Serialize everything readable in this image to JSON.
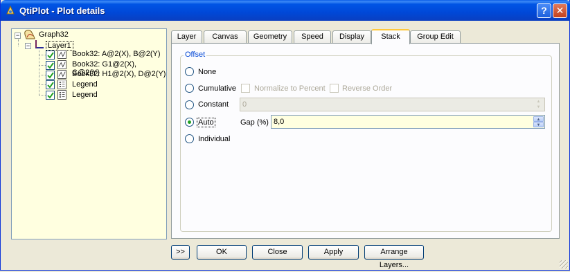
{
  "window": {
    "title": "QtiPlot - Plot details",
    "help_glyph": "?",
    "close_glyph": "✕"
  },
  "tree": {
    "graph_label": "Graph32",
    "layer_label": "Layer1",
    "items": [
      {
        "label": "Book32: A@2(X), B@2(Y)",
        "icon": "curve-icon",
        "checked": true
      },
      {
        "label": "Book32: G1@2(X), C@2(Y)",
        "icon": "curve-icon",
        "checked": true
      },
      {
        "label": "Book32: H1@2(X), D@2(Y)",
        "icon": "curve-icon",
        "checked": true
      },
      {
        "label": "Legend",
        "icon": "legend-icon",
        "checked": true
      },
      {
        "label": "Legend",
        "icon": "legend-icon",
        "checked": true
      }
    ]
  },
  "tabs": [
    "Layer",
    "Canvas",
    "Geometry",
    "Speed",
    "Display",
    "Stack",
    "Group Edit"
  ],
  "active_tab": "Stack",
  "offset": {
    "group_title": "Offset",
    "none_label": "None",
    "cumulative_label": "Cumulative",
    "normalize_label": "Normalize to Percent",
    "reverse_label": "Reverse Order",
    "constant_label": "Constant",
    "constant_value": "0",
    "auto_label": "Auto",
    "gap_label": "Gap (%)",
    "gap_value": "8,0",
    "individual_label": "Individual",
    "selected": "Auto"
  },
  "buttons": {
    "expand": ">>",
    "ok": "OK",
    "close": "Close",
    "apply": "Apply",
    "arrange": "Arrange Layers..."
  },
  "colors": {
    "accent": "#0046d5",
    "tree_background": "#ffffe0",
    "active_tab_highlight": "#ffc83c"
  }
}
